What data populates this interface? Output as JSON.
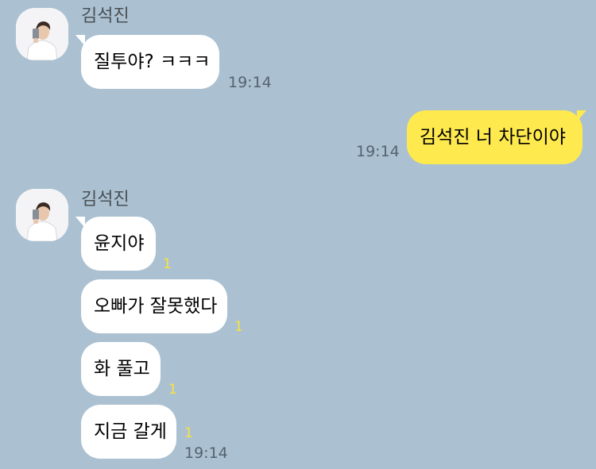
{
  "chat": {
    "sender_name": "김석진",
    "group1": {
      "message1": {
        "text": "질투야? ㅋㅋㅋ",
        "time": "19:14"
      }
    },
    "my_message": {
      "text": "김석진 너 차단이야",
      "time": "19:14"
    },
    "group2": {
      "messages": [
        {
          "text": "윤지야",
          "unread": "1"
        },
        {
          "text": "오빠가 잘못했다",
          "unread": "1"
        },
        {
          "text": "화 풀고",
          "unread": "1"
        },
        {
          "text": "지금 갈게",
          "unread": "1",
          "time": "19:14"
        }
      ]
    }
  },
  "colors": {
    "background": "#abc1d1",
    "incoming_bubble": "#ffffff",
    "outgoing_bubble": "#fee94f",
    "unread_count": "#f8e43a"
  },
  "icons": {
    "avatar": "profile-photo"
  }
}
